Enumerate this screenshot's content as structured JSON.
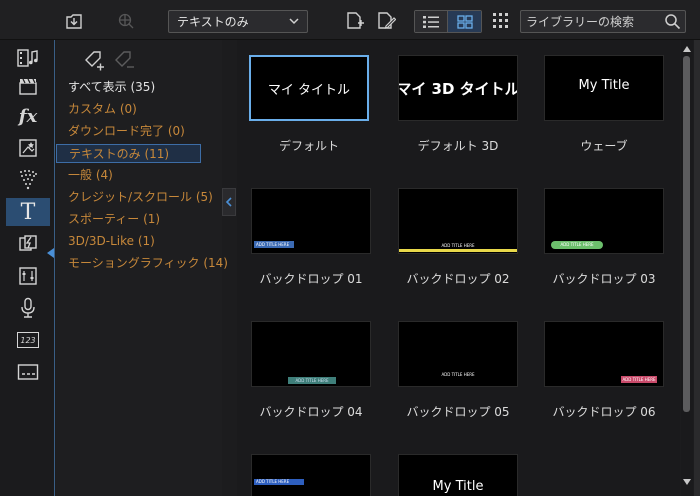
{
  "toolbar": {
    "filter_value": "テキストのみ",
    "search_placeholder": "ライブラリーの検索",
    "icons": [
      "import-icon",
      "fx-icon",
      "chevron-down-icon",
      "new-title-icon",
      "edit-title-icon",
      "list-view-icon",
      "grid-view-icon",
      "sort-icon",
      "search-icon"
    ]
  },
  "rail": {
    "items": [
      {
        "name": "media-room-icon"
      },
      {
        "name": "clapper-icon"
      },
      {
        "name": "fx-room-icon",
        "text": "fx"
      },
      {
        "name": "pip-room-icon"
      },
      {
        "name": "particle-room-icon"
      },
      {
        "name": "title-room-icon",
        "text": "T"
      },
      {
        "name": "transition-room-icon"
      },
      {
        "name": "audio-mixing-icon"
      },
      {
        "name": "microphone-icon"
      },
      {
        "name": "chapter-room-icon",
        "text": "123"
      },
      {
        "name": "subtitle-room-icon"
      }
    ],
    "active_index": 5
  },
  "categories": {
    "items": [
      {
        "label": "すべて表示 (35)"
      },
      {
        "label": "カスタム (0)"
      },
      {
        "label": "ダウンロード完了 (0)"
      },
      {
        "label": "テキストのみ (11)"
      },
      {
        "label": "一般 (4)"
      },
      {
        "label": "クレジット/スクロール (5)"
      },
      {
        "label": "スポーティー (1)"
      },
      {
        "label": "3D/3D-Like (1)"
      },
      {
        "label": "モーショングラフィック (14)"
      }
    ],
    "selected_index": 3
  },
  "library": {
    "tiles": [
      {
        "label": "デフォルト",
        "thumb_text": "マイ タイトル",
        "selected": true
      },
      {
        "label": "デフォルト 3D",
        "thumb_text": "マイ 3D タイトル"
      },
      {
        "label": "ウェーブ",
        "thumb_text": "My Title"
      },
      {
        "label": "バックドロップ 01",
        "thumb_text": "ADD TITLE HERE"
      },
      {
        "label": "バックドロップ 02",
        "thumb_text": "ADD TITLE HERE"
      },
      {
        "label": "バックドロップ 03",
        "thumb_text": "ADD TITLE HERE"
      },
      {
        "label": "バックドロップ 04",
        "thumb_text": "ADD TITLE HERE"
      },
      {
        "label": "バックドロップ 05",
        "thumb_text": "ADD TITLE HERE"
      },
      {
        "label": "バックドロップ 06",
        "thumb_text": "ADD TITLE HERE"
      },
      {
        "label": "",
        "thumb_text": "ADD TITLE HERE"
      },
      {
        "label": "",
        "thumb_text": "My Title"
      }
    ]
  },
  "colors": {
    "accent": "#4a8fd6",
    "category_text": "#c7883a",
    "selection_border": "#6aaeea",
    "backdrop_02": "#e8d84a",
    "backdrop_03": "#6cbf6c",
    "backdrop_06": "#c94a6a"
  }
}
